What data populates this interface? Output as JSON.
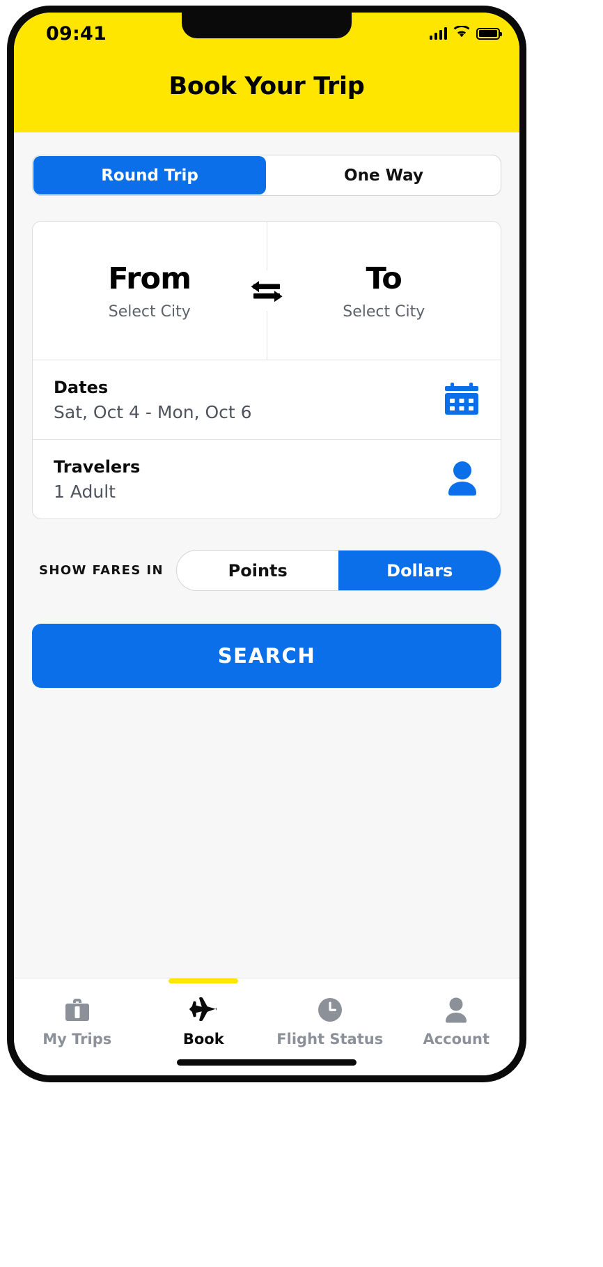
{
  "status_bar": {
    "time": "09:41",
    "signal_icon": "cellular-signal-icon",
    "wifi_icon": "wifi-icon",
    "battery_icon": "battery-icon"
  },
  "header": {
    "title": "Book Your Trip",
    "background_color": "#ffe600",
    "text_color": "#000000"
  },
  "trip_type": {
    "options": [
      {
        "label": "Round Trip",
        "active": true
      },
      {
        "label": "One Way",
        "active": false
      }
    ],
    "active_color": "#0a6fe8"
  },
  "search_card": {
    "origin": {
      "title": "From",
      "subtitle": "Select City"
    },
    "destination": {
      "title": "To",
      "subtitle": "Select City"
    },
    "swap_icon": "swap-horizontal-arrows-icon",
    "dates": {
      "label": "Dates",
      "value": "Sat, Oct 4 - Mon, Oct 6",
      "icon": "calendar-icon"
    },
    "travelers": {
      "label": "Travelers",
      "value": "1 Adult",
      "icon": "person-icon"
    }
  },
  "fares": {
    "label": "SHOW FARES IN",
    "options": [
      {
        "label": "Points",
        "active": false
      },
      {
        "label": "Dollars",
        "active": true
      }
    ]
  },
  "search_button": {
    "label": "SEARCH",
    "color": "#0a6fe8"
  },
  "bottom_nav": {
    "items": [
      {
        "label": "My Trips",
        "icon": "briefcase-icon",
        "active": false
      },
      {
        "label": "Book",
        "icon": "airplane-icon",
        "active": true
      },
      {
        "label": "Flight Status",
        "icon": "clock-icon",
        "active": false
      },
      {
        "label": "Account",
        "icon": "person-icon",
        "active": false
      }
    ],
    "active_indicator_color": "#ffe600"
  }
}
